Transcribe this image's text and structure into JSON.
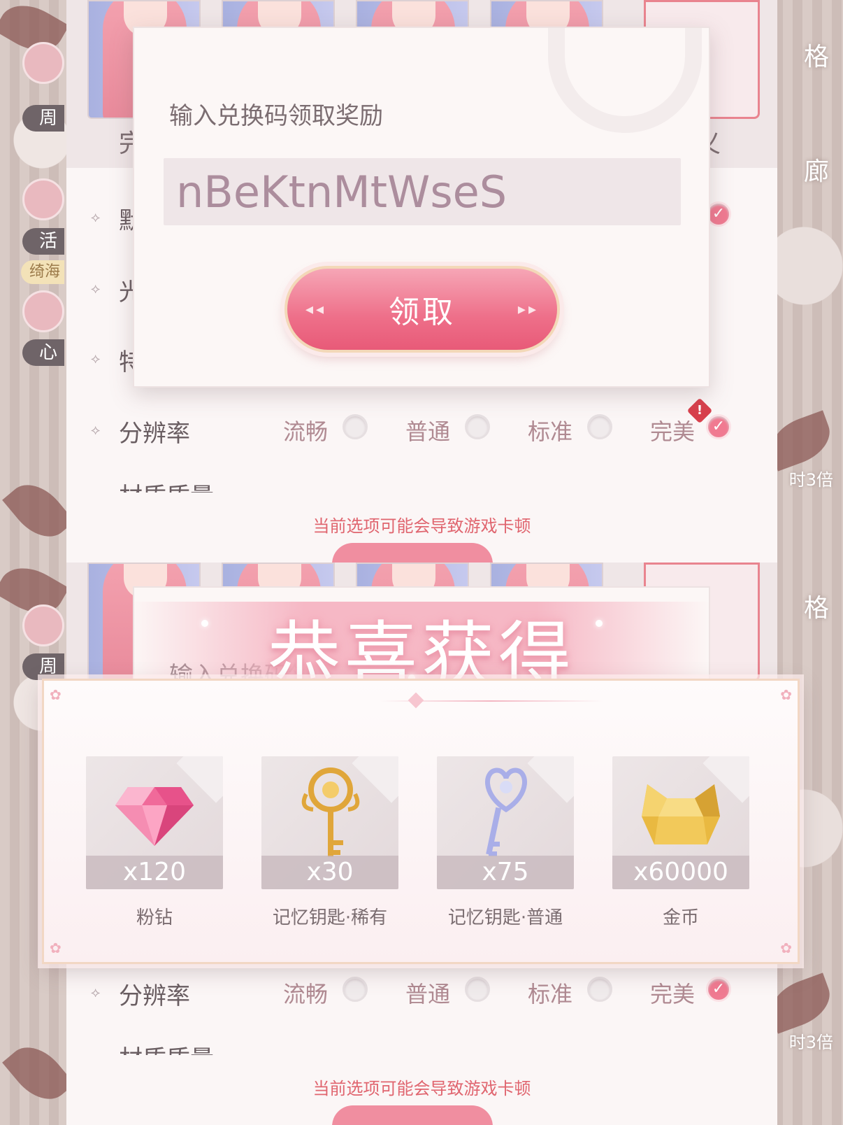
{
  "settings": {
    "portrait_labels": [
      "完",
      "义"
    ],
    "rows": [
      {
        "label": "默"
      },
      {
        "label": "光"
      },
      {
        "label": "特"
      }
    ],
    "resolution": {
      "label": "分辨率",
      "options": [
        "流畅",
        "普通",
        "标准",
        "完美"
      ],
      "selected": "完美"
    },
    "cut_row_label": "材质质量",
    "warning": "当前选项可能会导致游戏卡顿"
  },
  "left_rail": {
    "badge_week": "周",
    "badge_activity": "活",
    "badge_gold": "绮海",
    "badge_heart": "心"
  },
  "right_rail": {
    "item_a": "格",
    "item_b": "廊",
    "item_c": "时3倍"
  },
  "redeem": {
    "title": "输入兑换码领取奖励",
    "code_value": "nBeKtnMtWseS",
    "claim_label": "领取"
  },
  "reward": {
    "title": "恭喜获得",
    "items": [
      {
        "icon": "pink-diamond-icon",
        "qty": "x120",
        "name": "粉钻"
      },
      {
        "icon": "gold-key-icon",
        "qty": "x30",
        "name": "记忆钥匙·稀有"
      },
      {
        "icon": "silver-key-icon",
        "qty": "x75",
        "name": "记忆钥匙·普通"
      },
      {
        "icon": "gold-coin-cat-icon",
        "qty": "x60000",
        "name": "金币"
      }
    ]
  },
  "colors": {
    "accent": "#ee6f89",
    "warning": "#e0656f",
    "panel": "#fbf6f6"
  }
}
